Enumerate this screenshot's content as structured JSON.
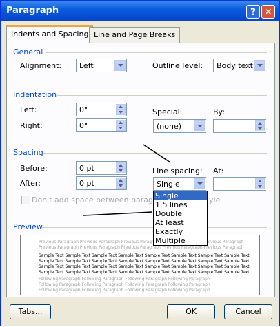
{
  "window": {
    "title": "Paragraph",
    "help_glyph": "?",
    "close_glyph": "✕"
  },
  "tabs": [
    {
      "label": "Indents and Spacing"
    },
    {
      "label": "Line and Page Breaks"
    }
  ],
  "general": {
    "section_label": "General",
    "alignment_label": "Alignment:",
    "alignment_value": "Left",
    "outline_label": "Outline level:",
    "outline_value": "Body text"
  },
  "indentation": {
    "section_label": "Indentation",
    "left_label": "Left:",
    "left_value": "0\"",
    "right_label": "Right:",
    "right_value": "0\"",
    "special_label": "Special:",
    "special_value": "(none)",
    "by_label": "By:",
    "by_value": ""
  },
  "spacing": {
    "section_label": "Spacing",
    "before_label": "Before:",
    "before_value": "0 pt",
    "after_label": "After:",
    "after_value": "0 pt",
    "line_spacing_label": "Line spacing:",
    "line_spacing_value": "Single",
    "at_label": "At:",
    "at_value": "",
    "no_space_label": "Don't add space between paragraph",
    "no_space_tail": "yle",
    "no_space_checked": false
  },
  "line_spacing_options": [
    "Single",
    "1.5 lines",
    "Double",
    "At least",
    "Exactly",
    "Multiple"
  ],
  "line_spacing_selected": "Single",
  "preview": {
    "label": "Preview",
    "previous_lines": [
      "Previous Paragraph Previous Paragraph Previous Paragraph Previous Paragraph Previous Paragraph",
      "Previous Paragraph Previous Paragraph Previous Paragraph Previous Paragraph Previous Paragraph"
    ],
    "sample_lines": [
      "Sample Text Sample Text Sample Text Sample Text Sample Text Sample Text Sample Text Sample Text",
      "Sample Text Sample Text Sample Text Sample Text Sample Text Sample Text Sample Text Sample Text",
      "Sample Text Sample Text Sample Text Sample Text Sample Text Sample Text Sample Text Sample Text",
      "Sample Text Sample Text Sample Text Sample Text Sample Text Sample Text Sample Text Sample Text"
    ],
    "following_lines": [
      "Following Paragraph Following Paragraph Following Paragraph Following Paragraph",
      "Following Paragraph Following Paragraph Following Paragraph Following Paragraph",
      "Following Paragraph Following Paragraph Following Paragraph Following Paragraph"
    ]
  },
  "buttons": {
    "tabs": "Tabs...",
    "ok": "OK",
    "cancel": "Cancel"
  },
  "colors": {
    "title_bar": "#0a5ce0",
    "section_text": "#0046d5",
    "selection": "#316ac5",
    "dialog_bg": "#ece9d8"
  }
}
